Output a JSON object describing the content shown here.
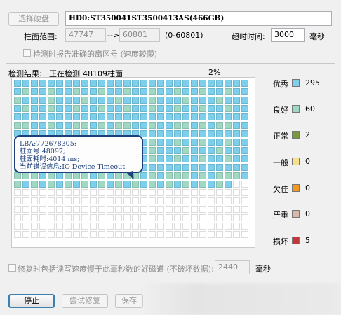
{
  "disk": {
    "select_button": "选择硬盘",
    "name": "HD0:ST350041ST3500413AS(466GB)"
  },
  "range": {
    "label": "柱面范围:",
    "from": "47747",
    "arrow": "-->",
    "to": "60801",
    "hint": "(0-60801)"
  },
  "timeout": {
    "label": "超时时间:",
    "value": "3000",
    "unit": "毫秒"
  },
  "accurate_report": {
    "label": "检测时报告准确的扇区号 (速度较慢)",
    "checked": false
  },
  "result": {
    "label": "检测结果:",
    "status": "正在检测",
    "cylinder": "48109柱面",
    "percent": "2%"
  },
  "legend": [
    {
      "label": "优秀",
      "count": "295",
      "color": "#7dd0ec"
    },
    {
      "label": "良好",
      "count": "60",
      "color": "#9fd9c4"
    },
    {
      "label": "正常",
      "count": "2",
      "color": "#7a9a3a"
    },
    {
      "label": "一般",
      "count": "0",
      "color": "#f6e18a"
    },
    {
      "label": "欠佳",
      "count": "0",
      "color": "#f29722"
    },
    {
      "label": "严重",
      "count": "0",
      "color": "#d8b8a8"
    },
    {
      "label": "损坏",
      "count": "5",
      "color": "#c1373b"
    }
  ],
  "tooltip": {
    "lba": "LBA:772678305;",
    "cylinder": "柱面号:48097;",
    "time": "柱面耗时:4014 ms;",
    "error": "当前错误信息:IO Device Timeout."
  },
  "repair_option": {
    "label": "修复时包括读写速度慢于此毫秒数的好磁道 (不破坏数据):",
    "value": "2440",
    "unit": "毫秒",
    "checked": false
  },
  "actions": {
    "stop": "停止",
    "try_repair": "尝试修复",
    "save": "保存"
  },
  "grid_colors": {
    "excellent": "#7dd0ec",
    "good": "#9fd9c4",
    "normal": "#7a9a3a",
    "damaged": "#c1373b",
    "pending": "#ffffff"
  }
}
